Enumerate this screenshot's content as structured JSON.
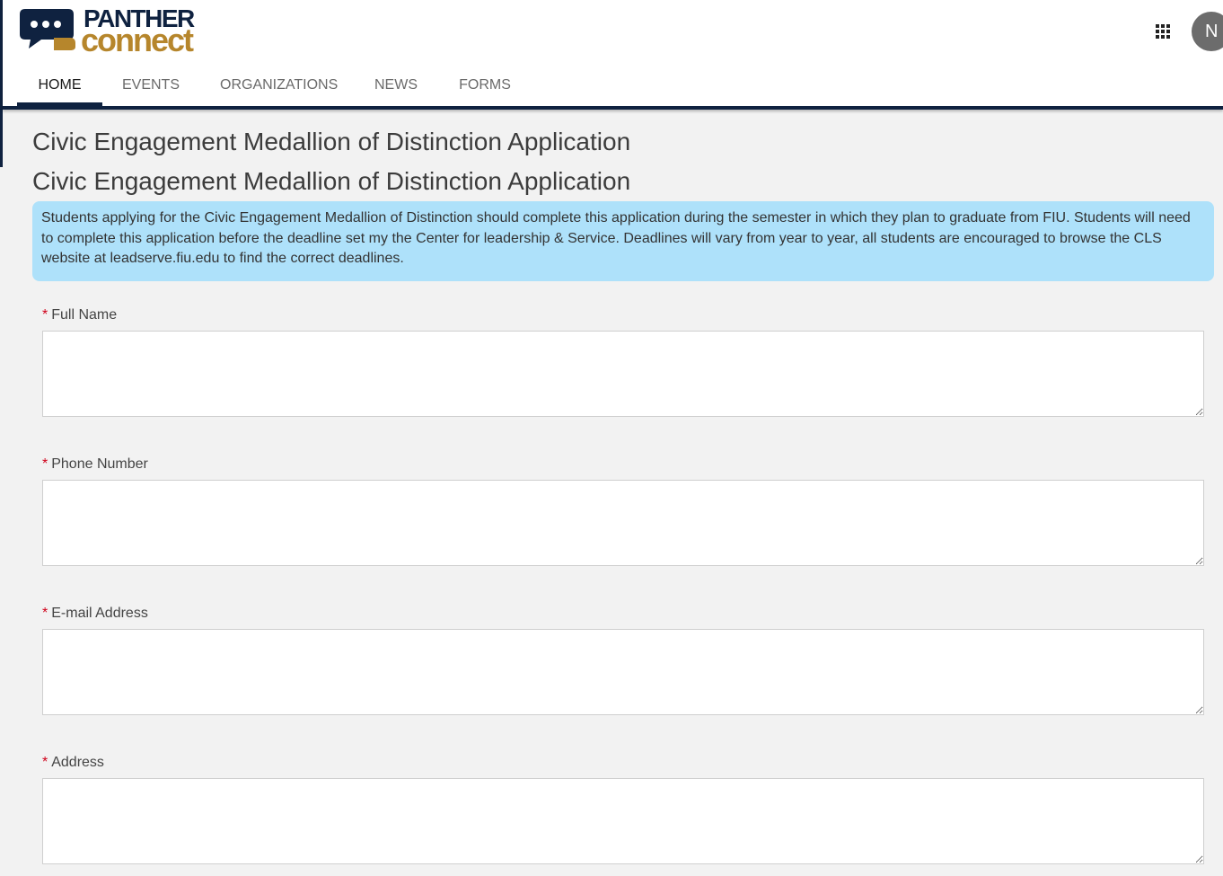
{
  "header": {
    "logo": {
      "line1": "PANTHER",
      "line2": "connect"
    },
    "avatar_initial": "N"
  },
  "nav": {
    "tabs": [
      {
        "label": "HOME",
        "active": true
      },
      {
        "label": "EVENTS",
        "active": false
      },
      {
        "label": "ORGANIZATIONS",
        "active": false
      },
      {
        "label": "NEWS",
        "active": false
      },
      {
        "label": "FORMS",
        "active": false
      }
    ]
  },
  "page": {
    "title": "Civic Engagement Medallion of Distinction Application",
    "form_title": "Civic Engagement Medallion of Distinction Application",
    "description": "Students applying for the Civic Engagement Medallion of Distinction should complete this application during the semester in which they plan to graduate from FIU. Students will need to complete this application before the deadline set my the Center for leadership & Service. Deadlines will vary from year to year, all students are encouraged to browse the CLS website at leadserve.fiu.edu to find the correct deadlines."
  },
  "form": {
    "required_marker": "*",
    "fields": [
      {
        "label": "Full Name",
        "value": ""
      },
      {
        "label": "Phone Number",
        "value": ""
      },
      {
        "label": "E-mail Address",
        "value": ""
      },
      {
        "label": "Address",
        "value": ""
      }
    ]
  },
  "colors": {
    "navy": "#0f2240",
    "gold": "#b6862c",
    "info_bg": "#aee1fa",
    "required": "#d0021b"
  }
}
